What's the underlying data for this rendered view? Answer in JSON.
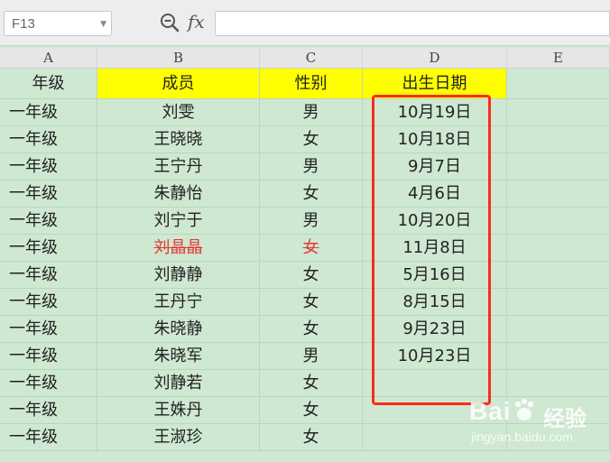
{
  "formula_bar": {
    "name_box": "F13",
    "fx_label": "fx",
    "formula_value": ""
  },
  "columns": [
    "A",
    "B",
    "C",
    "D",
    "E"
  ],
  "header_row": [
    "年级",
    "成员",
    "性别",
    "出生日期"
  ],
  "rows": [
    {
      "grade": "一年级",
      "member": "刘雯",
      "gender": "男",
      "birth": "10月19日",
      "strike": false
    },
    {
      "grade": "一年级",
      "member": "王晓晓",
      "gender": "女",
      "birth": "10月18日",
      "strike": false
    },
    {
      "grade": "一年级",
      "member": "王宁丹",
      "gender": "男",
      "birth": "9月7日",
      "strike": false
    },
    {
      "grade": "一年级",
      "member": "朱静怡",
      "gender": "女",
      "birth": "4月6日",
      "strike": false
    },
    {
      "grade": "一年级",
      "member": "刘宁于",
      "gender": "男",
      "birth": "10月20日",
      "strike": false
    },
    {
      "grade": "一年级",
      "member": "刘晶晶",
      "gender": "女",
      "birth": "11月8日",
      "strike": true
    },
    {
      "grade": "一年级",
      "member": "刘静静",
      "gender": "女",
      "birth": "5月16日",
      "strike": false
    },
    {
      "grade": "一年级",
      "member": "王丹宁",
      "gender": "女",
      "birth": "8月15日",
      "strike": false
    },
    {
      "grade": "一年级",
      "member": "朱晓静",
      "gender": "女",
      "birth": "9月23日",
      "strike": false
    },
    {
      "grade": "一年级",
      "member": "朱晓军",
      "gender": "男",
      "birth": "10月23日",
      "strike": false
    },
    {
      "grade": "一年级",
      "member": "刘静若",
      "gender": "女",
      "birth": "",
      "strike": false
    },
    {
      "grade": "一年级",
      "member": "王姝丹",
      "gender": "女",
      "birth": "",
      "strike": false
    },
    {
      "grade": "一年级",
      "member": "王淑珍",
      "gender": "女",
      "birth": "",
      "strike": false
    }
  ],
  "colors": {
    "sheet_bg": "#cfe8d2",
    "header_yellow": "#ffff00",
    "highlight_red": "#ff2a1a",
    "strike_red": "#e53935"
  },
  "watermark": {
    "brand": "Bai",
    "brand_cn": "经验",
    "url": "jingyan.baidu.com"
  }
}
